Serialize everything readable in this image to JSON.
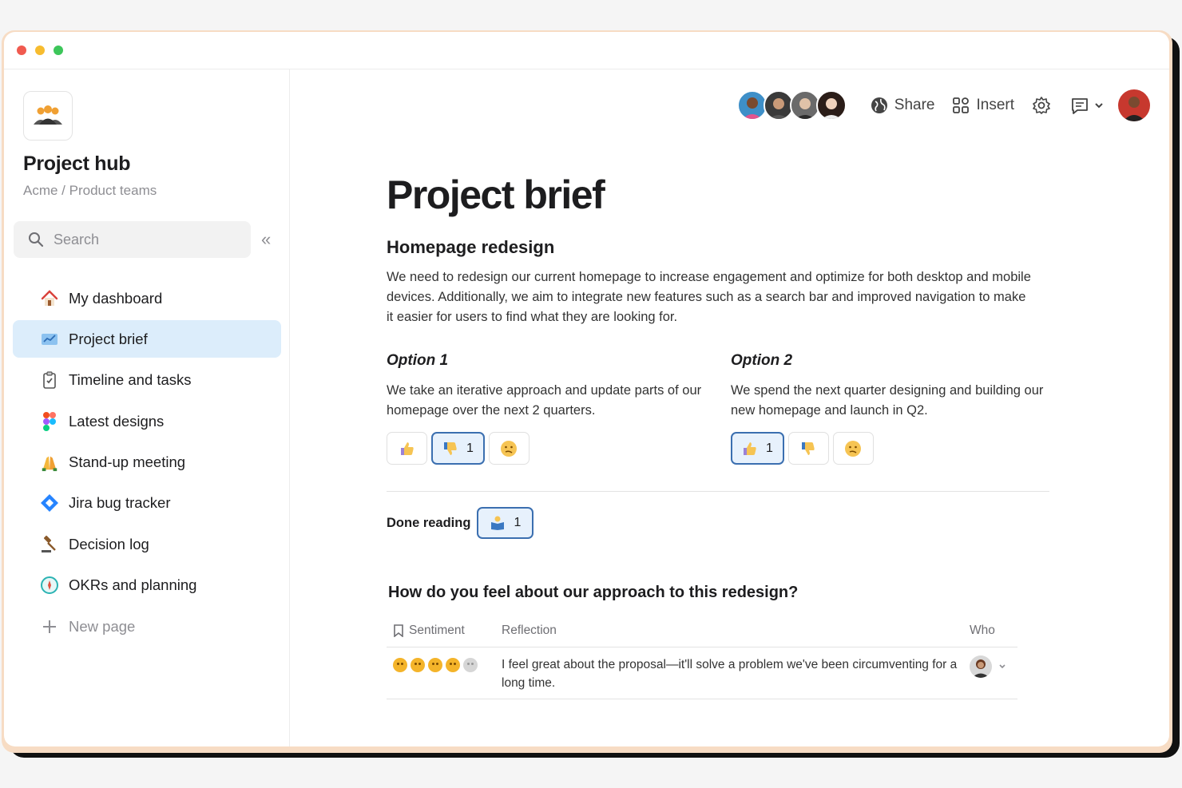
{
  "window": {
    "dots": [
      "#f05a4f",
      "#f7bc2f",
      "#3dc65a"
    ]
  },
  "sidebar": {
    "title": "Project hub",
    "breadcrumb": "Acme / Product teams",
    "search_placeholder": "Search",
    "items": [
      {
        "label": "My dashboard",
        "icon": "house-icon",
        "active": false
      },
      {
        "label": "Project brief",
        "icon": "chart-icon",
        "active": true
      },
      {
        "label": "Timeline and tasks",
        "icon": "clipboard-check-icon",
        "active": false
      },
      {
        "label": "Latest designs",
        "icon": "figma-icon",
        "active": false
      },
      {
        "label": "Stand-up meeting",
        "icon": "raised-hands-icon",
        "active": false
      },
      {
        "label": "Jira bug tracker",
        "icon": "jira-icon",
        "active": false
      },
      {
        "label": "Decision log",
        "icon": "gavel-icon",
        "active": false
      },
      {
        "label": "OKRs and planning",
        "icon": "compass-icon",
        "active": false
      }
    ],
    "new_page": "New page"
  },
  "topbar": {
    "share": "Share",
    "insert": "Insert",
    "avatar_colors": [
      "#3e8fc8",
      "#3a3a3a",
      "#6a6a6a",
      "#2b1d18"
    ],
    "user_avatar_color": "#c7382e"
  },
  "doc": {
    "title": "Project brief",
    "subtitle": "Homepage redesign",
    "paragraph": "We need to redesign our current homepage to increase engagement and optimize for both desktop and mobile devices. Additionally, we aim to integrate new features such as a search bar and improved navigation to make it easier for users to find what they are looking for.",
    "options": [
      {
        "title": "Option 1",
        "text": "We take an iterative approach and update parts of our homepage over the next 2 quarters.",
        "reactions": [
          {
            "icon": "thumbs-up-icon",
            "count": "",
            "selected": false
          },
          {
            "icon": "thumbs-down-icon",
            "count": "1",
            "selected": true
          },
          {
            "icon": "confused-face-icon",
            "count": "",
            "selected": false
          }
        ]
      },
      {
        "title": "Option 2",
        "text": "We spend the next quarter designing and building our new homepage and launch in Q2.",
        "reactions": [
          {
            "icon": "thumbs-up-icon",
            "count": "1",
            "selected": true
          },
          {
            "icon": "thumbs-down-icon",
            "count": "",
            "selected": false
          },
          {
            "icon": "confused-face-icon",
            "count": "",
            "selected": false
          }
        ]
      }
    ],
    "done_reading": {
      "label": "Done reading",
      "count": "1",
      "icon": "reading-book-icon"
    },
    "question": "How do you feel about our approach to this redesign?",
    "table": {
      "headers": {
        "sentiment": "Sentiment",
        "reflection": "Reflection",
        "who": "Who"
      },
      "rows": [
        {
          "rating": 4,
          "max": 5,
          "reflection": "I feel great about the proposal—it'll solve a problem we've been circumventing for a long time."
        }
      ]
    }
  }
}
